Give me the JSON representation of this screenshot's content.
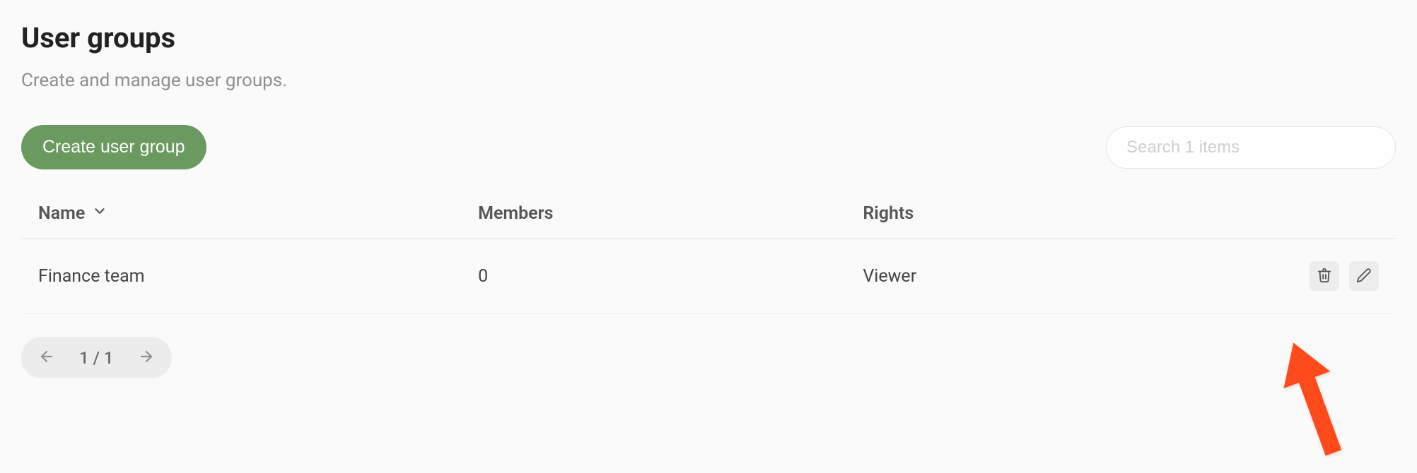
{
  "header": {
    "title": "User groups",
    "subtitle": "Create and manage user groups."
  },
  "toolbar": {
    "create_label": "Create user group",
    "search_placeholder": "Search 1 items"
  },
  "table": {
    "columns": {
      "name": "Name",
      "members": "Members",
      "rights": "Rights"
    },
    "rows": [
      {
        "name": "Finance team",
        "members": "0",
        "rights": "Viewer"
      }
    ]
  },
  "pagination": {
    "label": "1 / 1"
  }
}
